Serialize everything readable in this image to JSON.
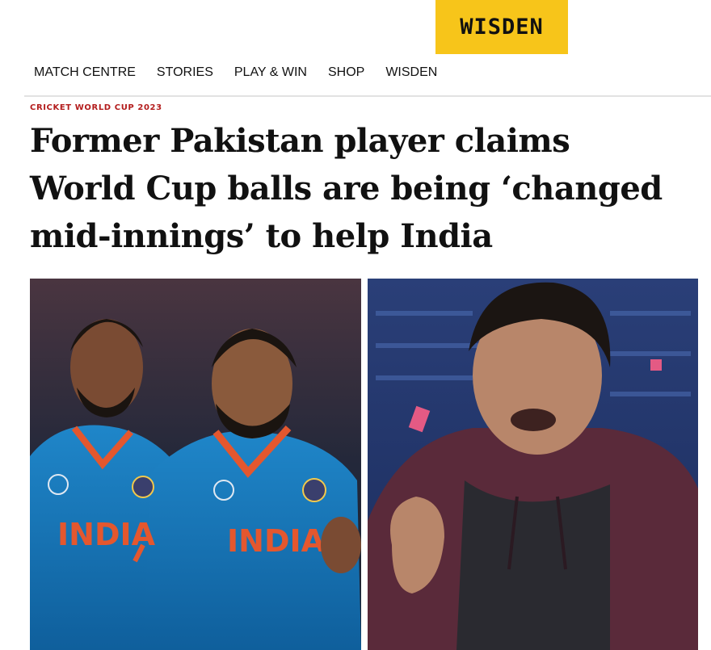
{
  "header": {
    "logo_text": "WISDEN",
    "logo_color": "#f7c51a"
  },
  "nav": {
    "items": [
      "MATCH CENTRE",
      "STORIES",
      "PLAY & WIN",
      "SHOP",
      "WISDEN"
    ]
  },
  "article": {
    "kicker": "CRICKET WORLD CUP 2023",
    "kicker_color": "#b31c1c",
    "headline": "Former Pakistan player claims World Cup balls are being ‘changed mid-innings’ to help India"
  },
  "images": {
    "left_jersey_text_1": "INDIA",
    "left_jersey_text_2": "INDIA"
  }
}
